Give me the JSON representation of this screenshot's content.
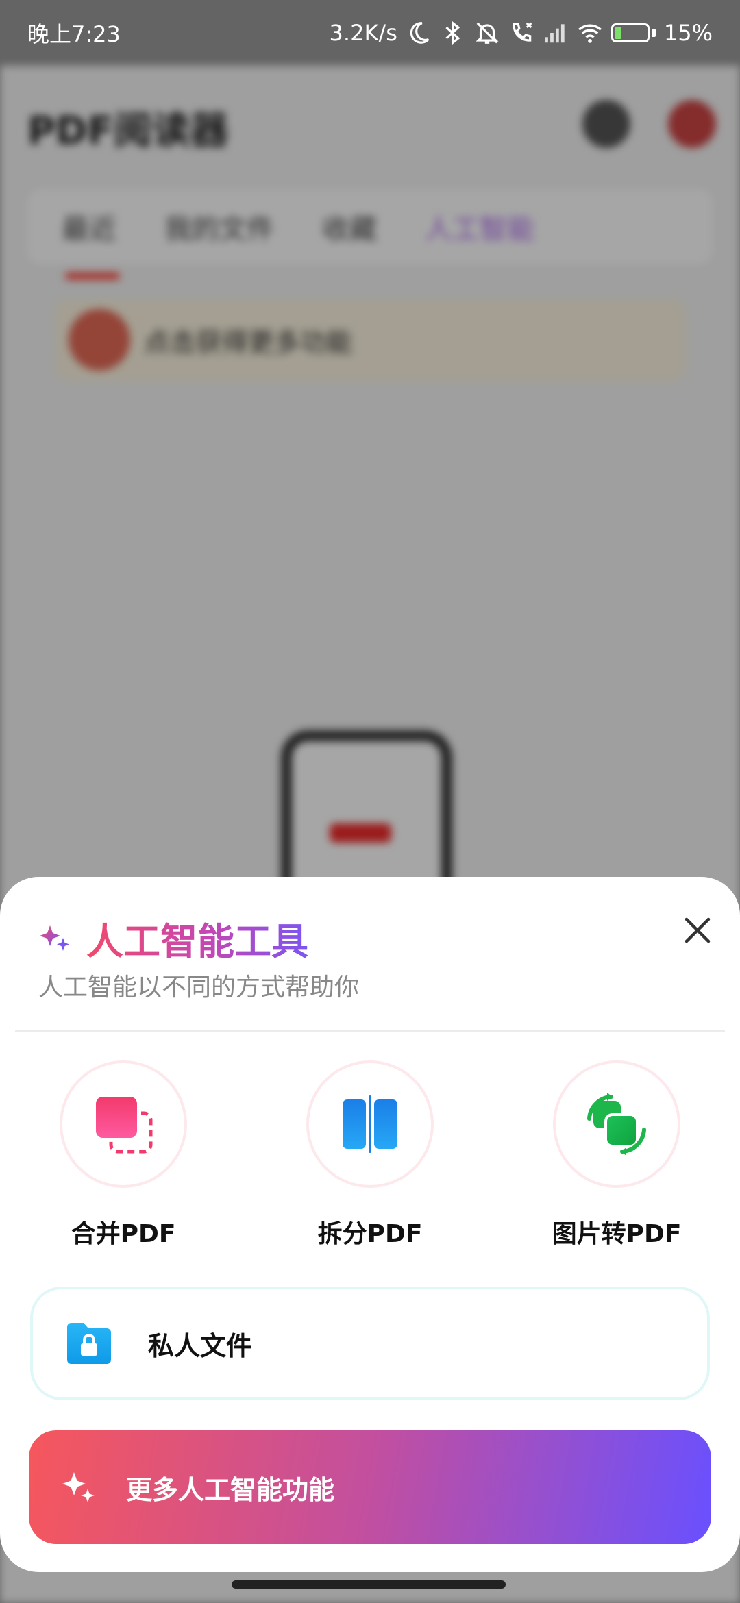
{
  "status_bar": {
    "time": "晚上7:23",
    "network_speed": "3.2K/s",
    "battery_percent": "15%",
    "icons": [
      "moon-icon",
      "bluetooth-icon",
      "mute-bell-icon",
      "call-icon",
      "signal-icon",
      "wifi-icon",
      "battery-icon"
    ]
  },
  "background_app": {
    "title": "PDF阅读器",
    "tabs": [
      "最近",
      "我的文件",
      "收藏",
      "人工智能"
    ],
    "banner_text": "点击获得更多功能"
  },
  "sheet": {
    "title": "人工智能工具",
    "subtitle": "人工智能以不同的方式帮助你",
    "close_icon": "close-icon",
    "tools": [
      {
        "label": "合并PDF",
        "icon": "merge-pdf-icon",
        "color": "#f23a6c"
      },
      {
        "label": "拆分PDF",
        "icon": "split-pdf-icon",
        "color": "#1e90f0"
      },
      {
        "label": "图片转PDF",
        "icon": "image-to-pdf-icon",
        "color": "#1db64a"
      }
    ],
    "private_files": {
      "label": "私人文件",
      "icon": "locked-folder-icon",
      "color": "#1aa8ee"
    },
    "more_button": {
      "label": "更多人工智能功能",
      "icon": "sparkle-icon"
    }
  },
  "colors": {
    "title_gradient_start": "#f2496b",
    "title_gradient_end": "#7b55f2",
    "button_gradient_start": "#f6575c",
    "button_gradient_end": "#6950ff"
  }
}
